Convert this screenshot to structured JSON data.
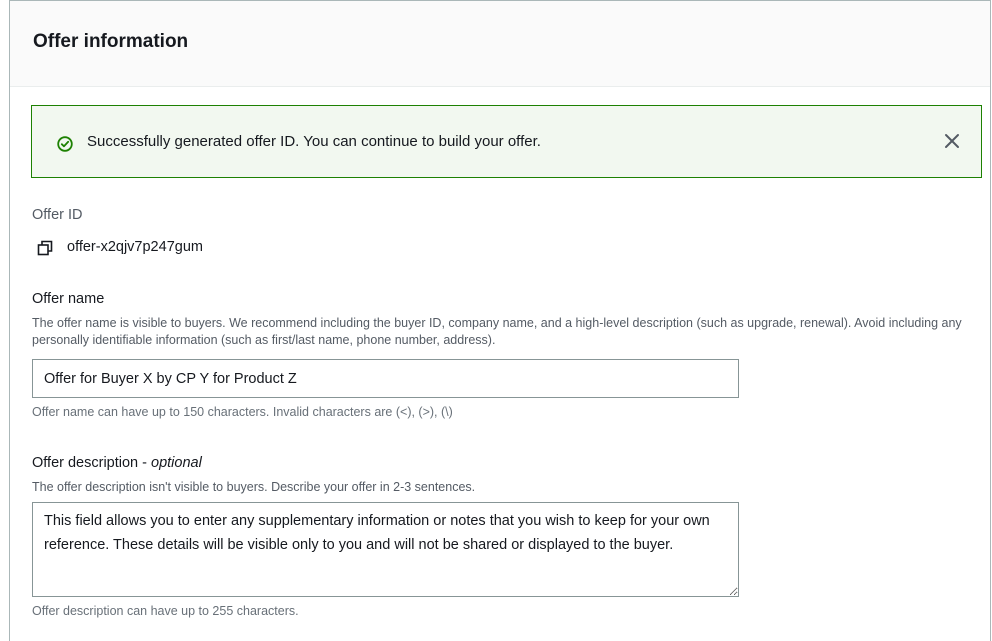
{
  "panel": {
    "title": "Offer information"
  },
  "flash": {
    "message": "Successfully generated offer ID. You can continue to build your offer.",
    "icon": "check-circle-icon",
    "close_icon": "close-icon",
    "color": "#1d8102"
  },
  "offer_id": {
    "label": "Offer ID",
    "value": "offer-x2qjv7p247gum",
    "icon": "copy-icon"
  },
  "offer_name": {
    "label": "Offer name",
    "description": "The offer name is visible to buyers. We recommend including the buyer ID, company name, and a high-level description (such as upgrade, renewal). Avoid including any personally identifiable information (such as first/last name, phone number, address).",
    "value": "Offer for Buyer X by CP Y for Product Z",
    "constraint": "Offer name can have up to 150 characters. Invalid characters are (<), (>), (\\)"
  },
  "offer_description": {
    "label": "Offer description - ",
    "optional": "optional",
    "description": "The offer description isn't visible to buyers. Describe your offer in 2-3 sentences.",
    "value": "This field allows you to enter any supplementary information or notes that you wish to keep for your own reference. These details will be visible only to you and will not be shared or displayed to the buyer.",
    "constraint": "Offer description can have up to 255 characters."
  }
}
